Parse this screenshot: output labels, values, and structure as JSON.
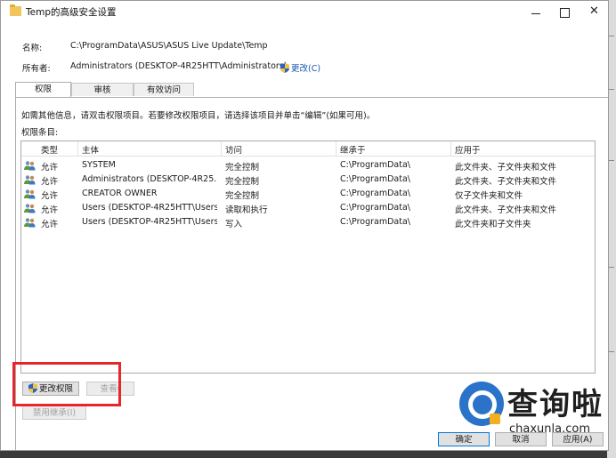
{
  "window": {
    "title": "Temp的高级安全设置",
    "minimize": "—",
    "maximize": "□",
    "close": "✕"
  },
  "props": {
    "name_label": "名称:",
    "name_value": "C:\\ProgramData\\ASUS\\ASUS Live Update\\Temp",
    "owner_label": "所有者:",
    "owner_value": "Administrators (DESKTOP-4R25HTT\\Administrators)",
    "change_link": "更改(C)"
  },
  "tabs": [
    {
      "label": "权限"
    },
    {
      "label": "审核"
    },
    {
      "label": "有效访问"
    }
  ],
  "info_text": "如需其他信息，请双击权限项目。若要修改权限项目，请选择该项目并单击“编辑”(如果可用)。",
  "entries_label": "权限条目:",
  "table": {
    "headers": [
      "类型",
      "主体",
      "访问",
      "继承于",
      "应用于"
    ],
    "rows": [
      {
        "type": "允许",
        "principal": "SYSTEM",
        "access": "完全控制",
        "inherited": "C:\\ProgramData\\",
        "applies": "此文件夹、子文件夹和文件"
      },
      {
        "type": "允许",
        "principal": "Administrators (DESKTOP-4R25...",
        "access": "完全控制",
        "inherited": "C:\\ProgramData\\",
        "applies": "此文件夹、子文件夹和文件"
      },
      {
        "type": "允许",
        "principal": "CREATOR OWNER",
        "access": "完全控制",
        "inherited": "C:\\ProgramData\\",
        "applies": "仅子文件夹和文件"
      },
      {
        "type": "允许",
        "principal": "Users (DESKTOP-4R25HTT\\Users)",
        "access": "读取和执行",
        "inherited": "C:\\ProgramData\\",
        "applies": "此文件夹、子文件夹和文件"
      },
      {
        "type": "允许",
        "principal": "Users (DESKTOP-4R25HTT\\Users)",
        "access": "写入",
        "inherited": "C:\\ProgramData\\",
        "applies": "此文件夹和子文件夹"
      }
    ]
  },
  "buttons": {
    "change_permissions": "更改权限",
    "view": "查看(",
    "disable_inheritance": "禁用继承(I)",
    "ok": "确定",
    "cancel": "取消",
    "apply": "应用(A)"
  },
  "watermark": {
    "text": "查询啦",
    "url": "chaxunla.com"
  },
  "colors": {
    "highlight_box": "#e8262a",
    "link": "#1a56b0"
  }
}
